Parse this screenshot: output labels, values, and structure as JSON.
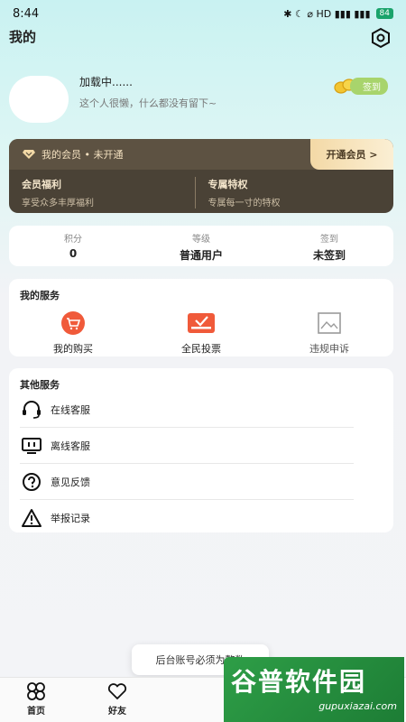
{
  "status_bar": {
    "time": "8:44",
    "icons_text": "✱ ☾ ⌀ HD ▮▮▮ ▮▮▮",
    "battery": "84"
  },
  "header": {
    "title": "我的"
  },
  "profile": {
    "name": "加载中......",
    "signature": "这个人很懒，什么都没有留下~",
    "signin_label": "签到"
  },
  "vip": {
    "status": "我的会员 • 未开通",
    "open_button": "开通会员 >",
    "benefits": [
      {
        "title": "会员福利",
        "desc": "享受众多丰厚福利"
      },
      {
        "title": "专属特权",
        "desc": "专属每一寸的特权"
      }
    ]
  },
  "stats": [
    {
      "label": "积分",
      "value": "0"
    },
    {
      "label": "等级",
      "value": "普通用户"
    },
    {
      "label": "签到",
      "value": "未签到"
    }
  ],
  "my_services": {
    "title": "我的服务",
    "items": [
      {
        "label": "我的购买",
        "icon": "cart-icon"
      },
      {
        "label": "全民投票",
        "icon": "vote-icon"
      },
      {
        "label": "违规申诉",
        "icon": "image-icon"
      }
    ]
  },
  "other_services": {
    "title": "其他服务",
    "items": [
      {
        "label": "在线客服",
        "icon": "headset-icon"
      },
      {
        "label": "离线客服",
        "icon": "monitor-icon"
      },
      {
        "label": "意见反馈",
        "icon": "question-icon"
      },
      {
        "label": "举报记录",
        "icon": "warning-icon"
      }
    ]
  },
  "toast": {
    "message": "后台账号必须为整数"
  },
  "tabbar": {
    "tabs": [
      {
        "label": "首页"
      },
      {
        "label": "好友"
      }
    ]
  },
  "watermark": {
    "cn": "谷普软件园",
    "en": "gupuxiazai.com"
  },
  "colors": {
    "accent_red": "#f05a3a",
    "vip_bg": "#4a4236",
    "vip_gold": "#f3d9a6",
    "signin_green": "#a8d46c"
  }
}
